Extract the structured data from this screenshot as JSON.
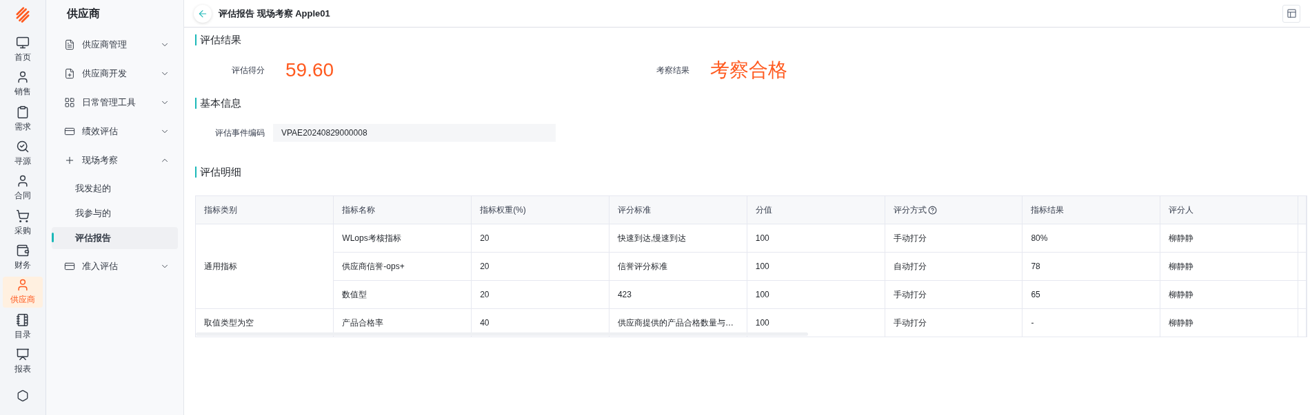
{
  "rail": {
    "items": [
      {
        "label": "首页",
        "selected": false
      },
      {
        "label": "销售",
        "selected": false
      },
      {
        "label": "需求",
        "selected": false
      },
      {
        "label": "寻源",
        "selected": false
      },
      {
        "label": "合同",
        "selected": false
      },
      {
        "label": "采购",
        "selected": false
      },
      {
        "label": "财务",
        "selected": false
      },
      {
        "label": "供应商",
        "selected": true
      },
      {
        "label": "目录",
        "selected": false
      },
      {
        "label": "报表",
        "selected": false
      }
    ]
  },
  "sidebar": {
    "title": "供应商",
    "items": [
      {
        "label": "供应商管理",
        "expanded": false
      },
      {
        "label": "供应商开发",
        "expanded": false
      },
      {
        "label": "日常管理工具",
        "expanded": false
      },
      {
        "label": "绩效评估",
        "expanded": false
      },
      {
        "label": "现场考察",
        "expanded": true,
        "children": [
          {
            "label": "我发起的",
            "selected": false
          },
          {
            "label": "我参与的",
            "selected": false
          },
          {
            "label": "评估报告",
            "selected": true
          }
        ]
      },
      {
        "label": "准入评估",
        "expanded": false
      }
    ]
  },
  "header": {
    "title": "评估报告 现场考察 Apple01"
  },
  "result": {
    "title": "评估结果",
    "score_label": "评估得分",
    "score": "59.60",
    "verdict_label": "考察结果",
    "verdict": "考察合格"
  },
  "basic": {
    "title": "基本信息",
    "field_label": "评估事件编码",
    "field_value": "VPAE20240829000008"
  },
  "detail": {
    "title": "评估明细",
    "columns": [
      "指标类别",
      "指标名称",
      "指标权重(%)",
      "评分标准",
      "分值",
      "评分方式",
      "指标结果",
      "评分人"
    ],
    "groups": [
      {
        "category": "通用指标",
        "rows": [
          [
            "WLops考核指标",
            "20",
            "快速到达,慢速到达",
            "100",
            "手动打分",
            "80%",
            "柳静静"
          ],
          [
            "供应商信誉-ops+",
            "20",
            "信誉评分标准",
            "100",
            "自动打分",
            "78",
            "柳静静"
          ],
          [
            "数值型",
            "20",
            "423",
            "100",
            "手动打分",
            "65",
            "柳静静"
          ]
        ]
      },
      {
        "category": "取值类型为空",
        "rows": [
          [
            "产品合格率",
            "40",
            "供应商提供的产品合格数量与…",
            "100",
            "手动打分",
            "-",
            "柳静静"
          ]
        ]
      }
    ]
  }
}
